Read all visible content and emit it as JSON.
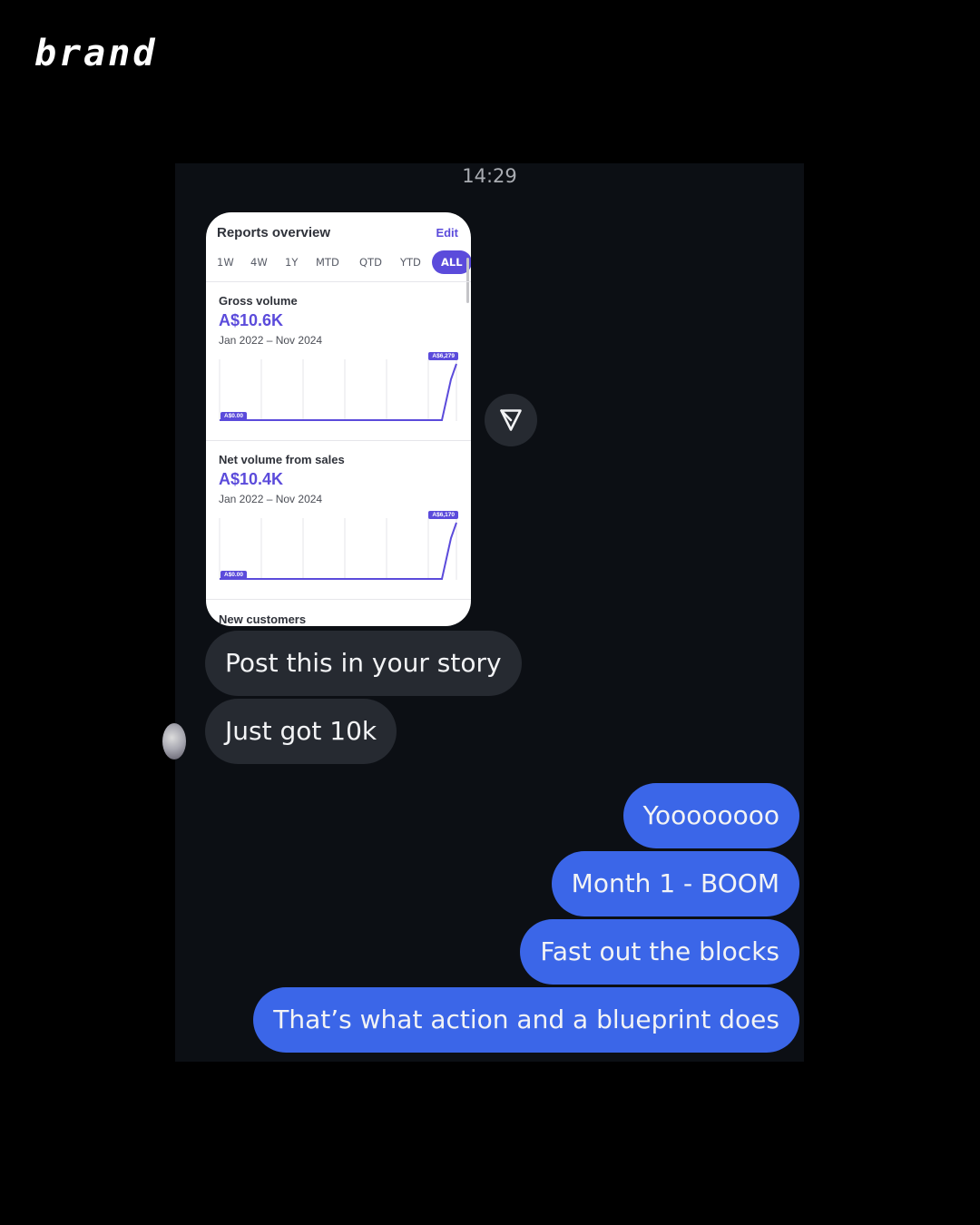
{
  "brand": {
    "logo_text": "brand"
  },
  "chat": {
    "timestamp": "14:29",
    "report_card": {
      "title": "Reports overview",
      "edit_label": "Edit",
      "tabs": [
        "1W",
        "4W",
        "1Y",
        "MTD",
        "QTD",
        "YTD",
        "ALL"
      ],
      "active_tab": "ALL",
      "sections": [
        {
          "title": "Gross volume",
          "value": "A$10.6K",
          "range": "Jan 2022 – Nov 2024",
          "tag_low": "A$0.00",
          "tag_high": "A$6,279"
        },
        {
          "title": "Net volume from sales",
          "value": "A$10.4K",
          "range": "Jan 2022 – Nov 2024",
          "tag_low": "A$0.00",
          "tag_high": "A$6,170"
        }
      ],
      "next_section_title": "New customers",
      "accent_color": "#5b4bdb"
    },
    "share_icon": "send-icon",
    "messages": [
      {
        "direction": "incoming",
        "text": "Post this in your story"
      },
      {
        "direction": "incoming",
        "text": "Just got 10k"
      },
      {
        "direction": "outgoing",
        "text": "Yoooooooo"
      },
      {
        "direction": "outgoing",
        "text": "Month 1 - BOOM"
      },
      {
        "direction": "outgoing",
        "text": "Fast out the blocks"
      },
      {
        "direction": "outgoing",
        "text": "That’s what action and a blueprint does"
      }
    ],
    "colors": {
      "incoming_bubble": "#262a31",
      "outgoing_bubble": "#3b66e8",
      "background": "#0c0f14"
    }
  }
}
